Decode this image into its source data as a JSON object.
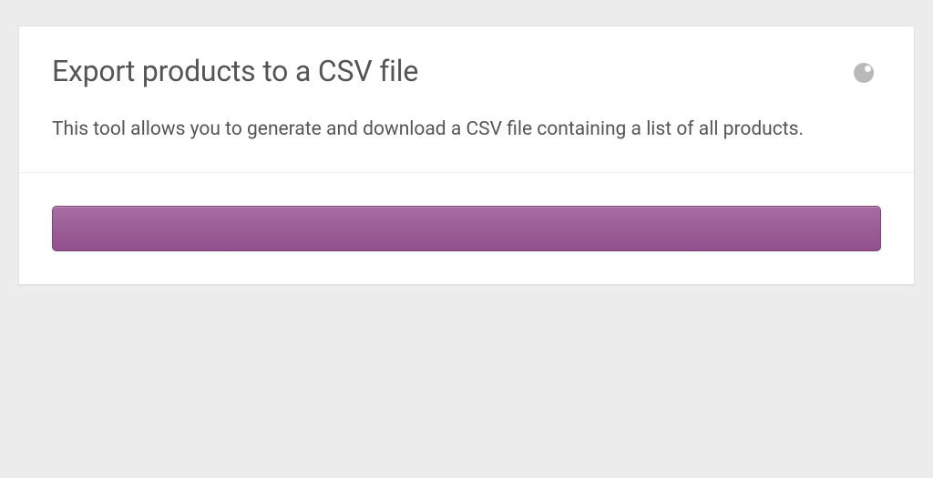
{
  "export_panel": {
    "title": "Export products to a CSV file",
    "description": "This tool allows you to generate and download a CSV file containing a list of all products.",
    "progress_percent": 100
  },
  "colors": {
    "panel_bg": "#ffffff",
    "page_bg": "#ececec",
    "text": "#555555",
    "progress_start": "#a76ca1",
    "progress_end": "#91508c",
    "indicator": "#b9b9b9"
  }
}
